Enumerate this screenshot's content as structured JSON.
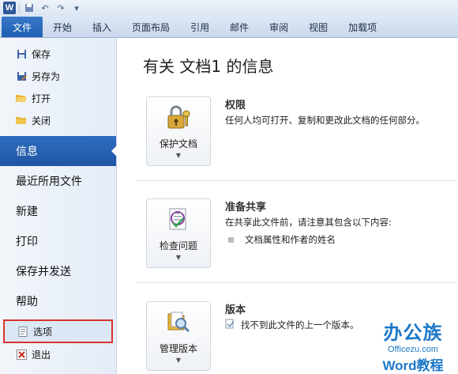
{
  "quick_access": {
    "app_icon": "W",
    "icons": [
      "save-icon",
      "undo-icon",
      "redo-icon",
      "customize-icon"
    ]
  },
  "ribbon_tabs": [
    "文件",
    "开始",
    "插入",
    "页面布局",
    "引用",
    "邮件",
    "审阅",
    "视图",
    "加载项"
  ],
  "backstage_nav": {
    "commands_top": [
      {
        "label": "保存",
        "icon": "save-icon"
      },
      {
        "label": "另存为",
        "icon": "save-as-icon"
      },
      {
        "label": "打开",
        "icon": "open-folder-icon"
      },
      {
        "label": "关闭",
        "icon": "close-folder-icon"
      }
    ],
    "tabs": [
      {
        "label": "信息",
        "active": true
      },
      {
        "label": "最近所用文件",
        "active": false
      },
      {
        "label": "新建",
        "active": false
      },
      {
        "label": "打印",
        "active": false
      },
      {
        "label": "保存并发送",
        "active": false
      },
      {
        "label": "帮助",
        "active": false
      }
    ],
    "commands_bottom": [
      {
        "label": "选项",
        "icon": "options-icon",
        "highlighted": true
      },
      {
        "label": "退出",
        "icon": "exit-icon"
      }
    ]
  },
  "main": {
    "title": "有关 文档1 的信息",
    "sections": [
      {
        "button_label": "保护文档",
        "icon": "protect-document-icon",
        "title": "权限",
        "description": "任何人均可打开、复制和更改此文档的任何部分。",
        "items": []
      },
      {
        "button_label": "检查问题",
        "icon": "check-issues-icon",
        "title": "准备共享",
        "description": "在共享此文件前，请注意其包含以下内容:",
        "items": [
          "文档属性和作者的姓名"
        ]
      },
      {
        "button_label": "管理版本",
        "icon": "manage-versions-icon",
        "title": "版本",
        "description": "找不到此文件的上一个版本。",
        "items": []
      }
    ]
  },
  "watermark": {
    "line1": "办公族",
    "line2": "Officezu.com",
    "line3": "Word教程"
  },
  "colors": {
    "active_tab": "#1f56a3",
    "highlight_border": "#d8342c",
    "watermark": "#1e78c8"
  }
}
